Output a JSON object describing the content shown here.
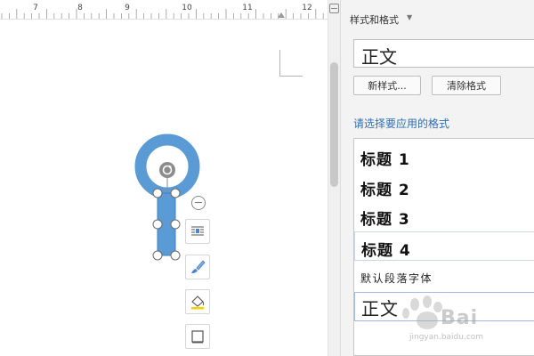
{
  "ruler": {
    "ticks": [
      "7",
      "8",
      "9",
      "10",
      "11",
      "12"
    ]
  },
  "panel": {
    "title": "样式和格式",
    "current_style": "正文",
    "new_style_label": "新样式...",
    "clear_format_label": "清除格式",
    "apply_label": "请选择要应用的格式",
    "styles": [
      "标题 1",
      "标题 2",
      "标题 3",
      "标题 4",
      "默认段落字体",
      "正文"
    ]
  },
  "watermark": {
    "brand": "Bai",
    "sub": "jingyan.baidu.com"
  },
  "colors": {
    "shape_fill": "#5b9bd5",
    "accent_text": "#2f6fb5"
  },
  "icons": [
    "rotate-icon",
    "minus-icon",
    "wrap-text-icon",
    "brush-icon",
    "fill-bucket-icon",
    "frame-icon"
  ]
}
